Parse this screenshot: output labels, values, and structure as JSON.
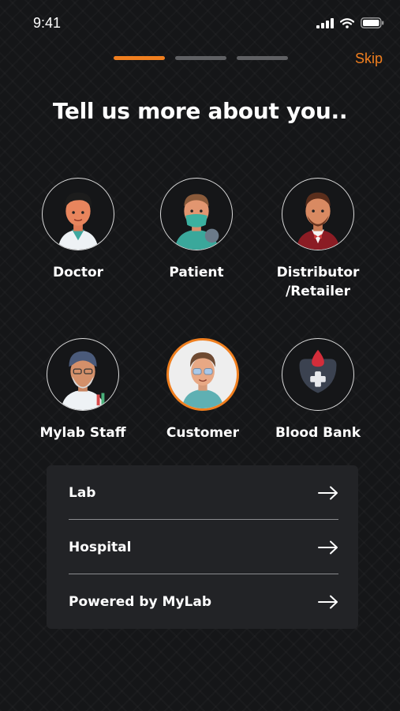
{
  "status_bar": {
    "time": "9:41"
  },
  "header": {
    "skip_label": "Skip",
    "steps_total": 3,
    "current_step": 1
  },
  "title": "Tell us more about you..",
  "roles": [
    {
      "label": "Doctor",
      "selected": false
    },
    {
      "label": "Patient",
      "selected": false
    },
    {
      "label": "Distributor\n/Retailer",
      "selected": false
    },
    {
      "label": "Mylab Staff",
      "selected": false
    },
    {
      "label": "Customer",
      "selected": true
    },
    {
      "label": "Blood Bank",
      "selected": false
    }
  ],
  "options": [
    {
      "label": "Lab",
      "icon": "arrow-right-icon"
    },
    {
      "label": "Hospital",
      "icon": "arrow-right-icon"
    },
    {
      "label": "Powered by MyLab",
      "icon": "arrow-right-icon"
    }
  ],
  "colors": {
    "accent": "#f07f1f",
    "background": "#151618",
    "card": "#222326"
  }
}
